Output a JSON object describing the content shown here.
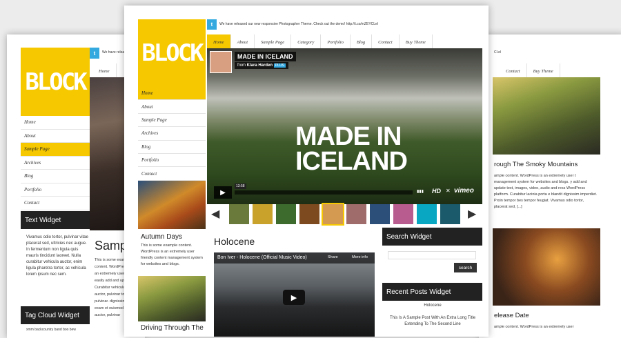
{
  "logo": "BLOCK",
  "left": {
    "twitter": "We have relea",
    "nav": [
      "Home",
      "About",
      "Sample Page",
      "Archives",
      "Blog",
      "Portfolio",
      "Contact"
    ],
    "active_nav": 2,
    "top_home": "Home",
    "widget_title": "Text Widget",
    "widget_text": "Vivamus odio tortor, pulvinar vitae placerat sed, ultricies nec augue. In fermentum non ligula quis mauris tincidunt laoreet. Nulla curabitur vehicula auctor, enim ligula pharetra tortor, ac vehicula lorem ipsum nec sem.",
    "tagcloud_title": "Tag Cloud Widget",
    "tagcloud_text": "xmm backcountry band boo bew",
    "post_title": "Samp",
    "post_text": "This is some example content. WordPress is an extremely user easily add and upd Curabitur vehicula auctor, pulvinar tortor, pulvinar. dignissim exam et euismod ma auctor, pulvinar"
  },
  "right": {
    "twitter": "Cl.el",
    "nav": [
      "Contact",
      "Buy Theme"
    ],
    "post1_title": "rough The Smoky Mountains",
    "post1_text": "ample content. WordPress is an extremely user t management system for websites and blogs. y add and update text, images, video, audio and ress WordPress platform. Curabitur lacinia porta e blandit dignissim imperdiet. Proin tempor bes tempor feugiat. Vivamus odio tortor, placerat sed, [...]",
    "post2_title": "elease Date",
    "post2_text": "ample content. WordPress is an extremely user"
  },
  "center": {
    "twitter": "We have released our new responsive Photographer Theme. Check out the demo! http://t.co/mZEYCLel",
    "topnav": [
      "Home",
      "About",
      "Sample Page",
      "Category",
      "Portfolio",
      "Blog",
      "Contact",
      "Buy Theme"
    ],
    "sidenav": [
      "Home",
      "About",
      "Sample Page",
      "Archives",
      "Blog",
      "Portfolio",
      "Contact"
    ],
    "video": {
      "title": "MADE IN ICELAND",
      "from": "from",
      "author": "Klara Harden",
      "badge": "PLUS",
      "overlay1": "MADE IN",
      "overlay2": "ICELAND",
      "time": "13:58",
      "hd": "HD",
      "brand": "vimeo"
    },
    "autumn_title": "Autumn Days",
    "autumn_text": "This is some example content. WordPress is an extremely user friendly content management system for websites and blogs.",
    "driving_title": "Driving Through The",
    "post_title": "Holocene",
    "yt": {
      "title": "Bon Iver - Holocene (Official Music Video)",
      "share": "Share",
      "more": "More info"
    },
    "search_title": "Search Widget",
    "search_button": "search",
    "recent_title": "Recent Posts Widget",
    "recent": [
      "Holocene",
      "This Is A Sample Post With An Extra Long Title Extending To The Second Line"
    ]
  },
  "colors": {
    "accent": "#f5c800",
    "dark": "#222222",
    "twitter": "#33a9e0"
  },
  "thumbs": [
    "#6a7a3a",
    "#c9a22c",
    "#3d6b2e",
    "#7c4a1e",
    "#d59a52",
    "#a06b6b",
    "#2c4f7a",
    "#b85c8f",
    "#0aa7c2",
    "#1a5a6a"
  ],
  "active_thumb": 4
}
